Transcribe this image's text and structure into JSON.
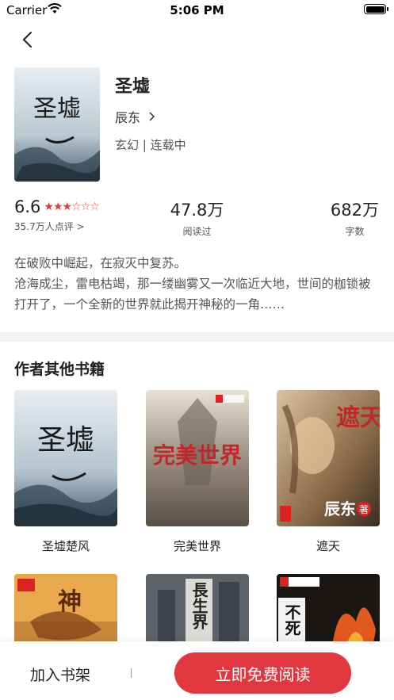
{
  "status_bar": {
    "carrier": "Carrier",
    "time": "5:06 PM"
  },
  "book": {
    "title": "圣墟",
    "author": "辰东",
    "tags": "玄幻 | 连载中",
    "cover_text": "圣墟"
  },
  "stats": {
    "rating": "6.6",
    "stars_filled": 3,
    "stars_total": 6,
    "rating_count": "35.7万人点评 >",
    "readers": "47.8万",
    "readers_label": "阅读过",
    "words": "682万",
    "words_label": "字数"
  },
  "description": {
    "line1": "在破败中崛起，在寂灭中复苏。",
    "line2": "沧海成尘，雷电枯竭，那一缕幽雾又一次临近大地，世间的枷锁被打开了，一个全新的世界就此揭开神秘的一角……"
  },
  "other_books": {
    "title": "作者其他书籍",
    "items": [
      {
        "name": "圣墟楚风",
        "cover_text": "圣墟"
      },
      {
        "name": "完美世界",
        "cover_text": "完美世界"
      },
      {
        "name": "遮天",
        "cover_text": "遮天",
        "cover_sub": "辰东",
        "cover_badge": "著"
      },
      {
        "name": "",
        "cover_text": "神"
      },
      {
        "name": "",
        "cover_text": "長生界"
      },
      {
        "name": "",
        "cover_text": "不死"
      }
    ]
  },
  "bottom_bar": {
    "shelf_label": "加入书架",
    "read_label": "立即免费阅读"
  },
  "colors": {
    "accent": "#e0383e",
    "star": "#e23b3b",
    "divider": "#f3f3f3"
  }
}
